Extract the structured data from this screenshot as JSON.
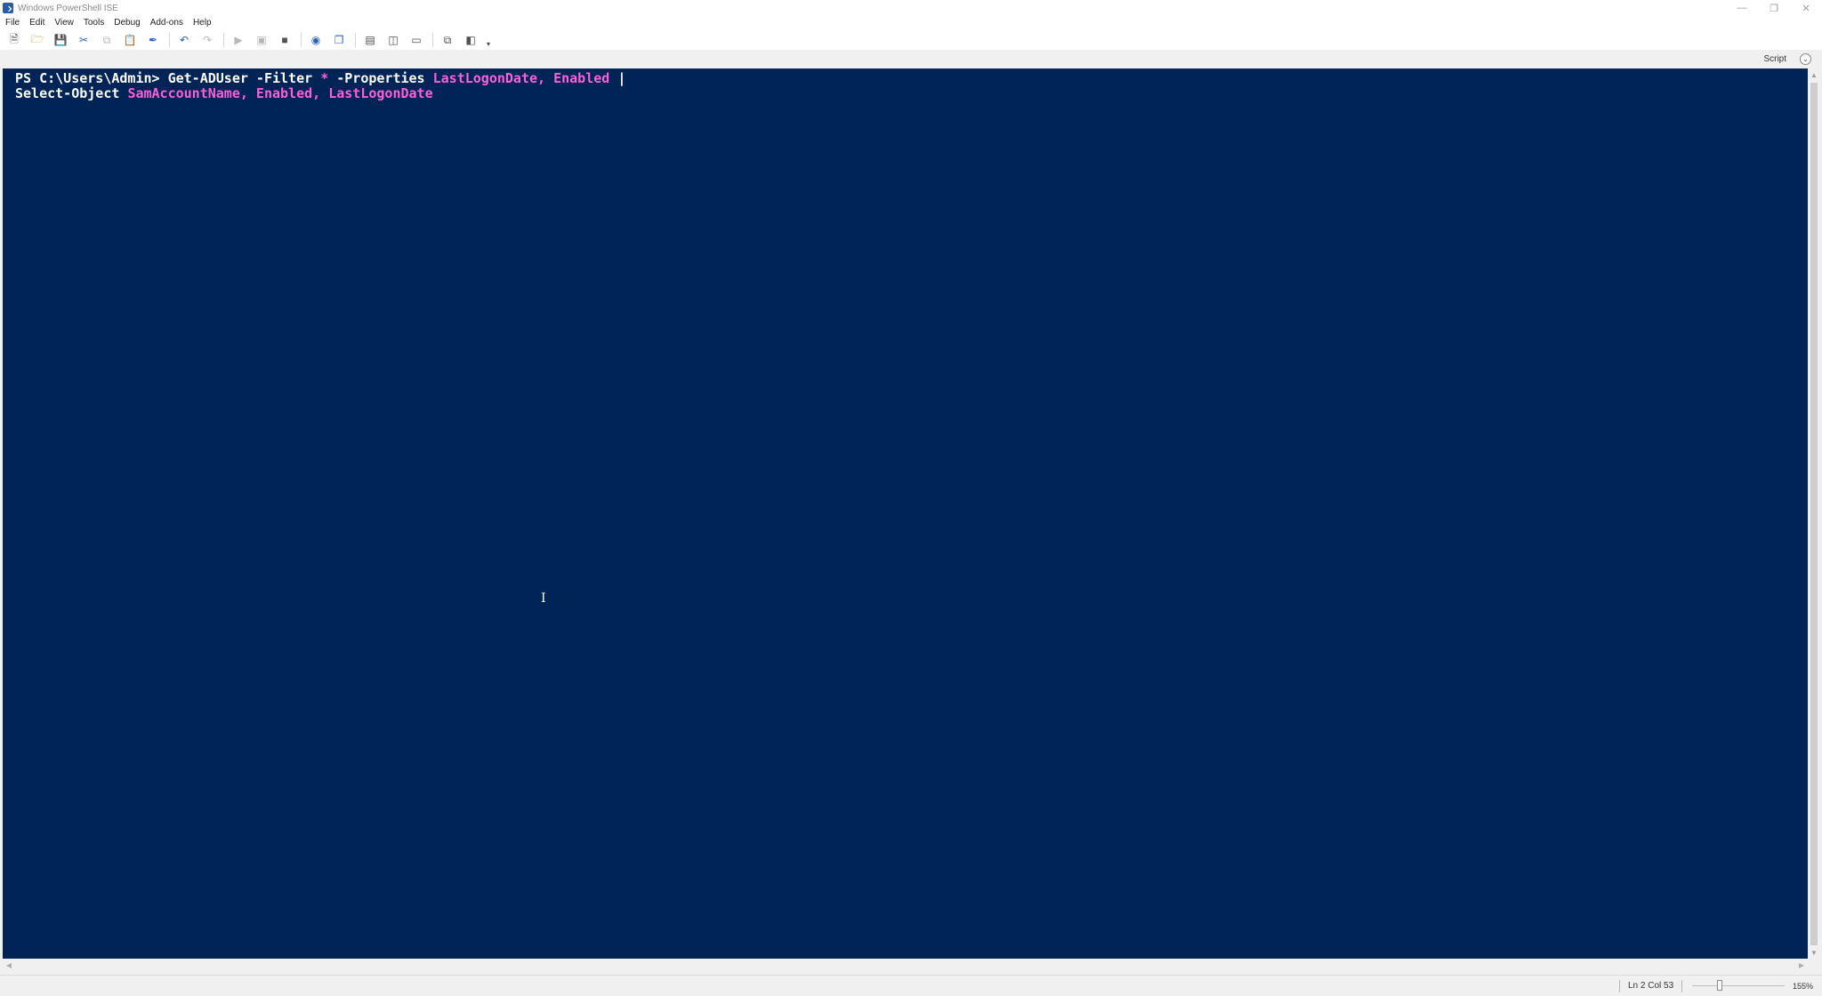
{
  "window": {
    "title": "Windows PowerShell ISE",
    "controls": [
      "minimize",
      "restore",
      "close"
    ]
  },
  "menu": {
    "items": [
      "File",
      "Edit",
      "View",
      "Tools",
      "Debug",
      "Add-ons",
      "Help"
    ]
  },
  "toolbar": {
    "buttons": [
      {
        "name": "new-script-icon"
      },
      {
        "name": "open-icon"
      },
      {
        "name": "save-icon"
      },
      {
        "name": "cut-icon"
      },
      {
        "name": "copy-icon"
      },
      {
        "name": "paste-icon"
      },
      {
        "name": "clear-console-icon"
      },
      {
        "name": "undo-icon"
      },
      {
        "name": "redo-icon"
      },
      {
        "name": "run-script-icon"
      },
      {
        "name": "run-selection-icon"
      },
      {
        "name": "stop-icon"
      },
      {
        "name": "remote-powershell-icon"
      },
      {
        "name": "start-powershell-icon"
      },
      {
        "name": "show-script-top-icon"
      },
      {
        "name": "show-script-right-icon"
      },
      {
        "name": "show-script-maximized-icon"
      },
      {
        "name": "show-command-window-icon"
      },
      {
        "name": "show-command-addon-icon"
      }
    ]
  },
  "scriptbar": {
    "label": "Script"
  },
  "console": {
    "line1": {
      "prompt": "PS C:\\Users\\Admin> ",
      "cmdlet": "Get-ADUser",
      "param1": " -Filter ",
      "star": "*",
      "param2": " -Properties ",
      "args": "LastLogonDate, Enabled",
      "pipe": " |"
    },
    "line2": {
      "cmdlet": "Select-Object ",
      "args": "SamAccountName, Enabled, LastLogonDate"
    }
  },
  "status": {
    "position": "Ln 2  Col 53",
    "zoom": "155%",
    "zoom_fraction": 0.3
  }
}
